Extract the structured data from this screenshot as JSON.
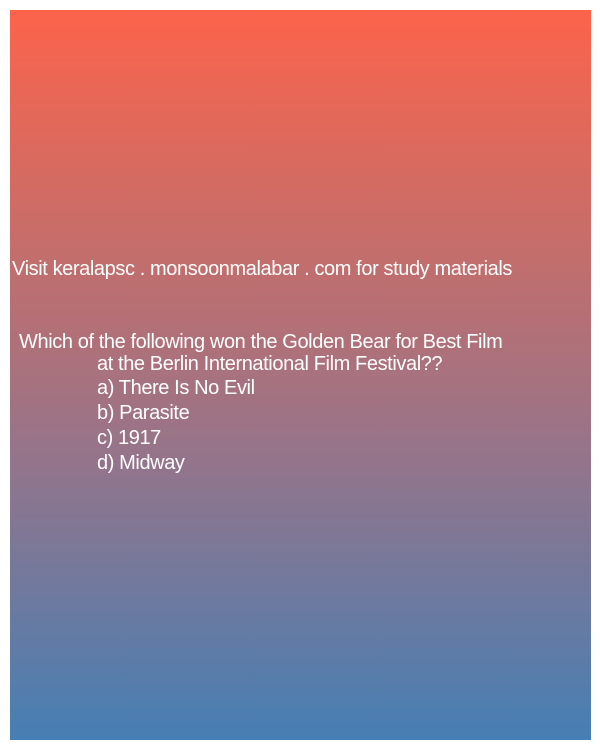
{
  "promo": "Visit keralapsc . monsoonmalabar . com for study materials",
  "question": {
    "line1": "Which of the following won the Golden Bear for Best Film",
    "line2": "at the Berlin International Film Festival??"
  },
  "options": [
    "a) There Is No Evil",
    "b) Parasite",
    "c) 1917",
    "d) Midway"
  ],
  "colors": {
    "gradient_top": "#fc634b",
    "gradient_bottom": "#467fb4",
    "text": "#ffffff"
  }
}
